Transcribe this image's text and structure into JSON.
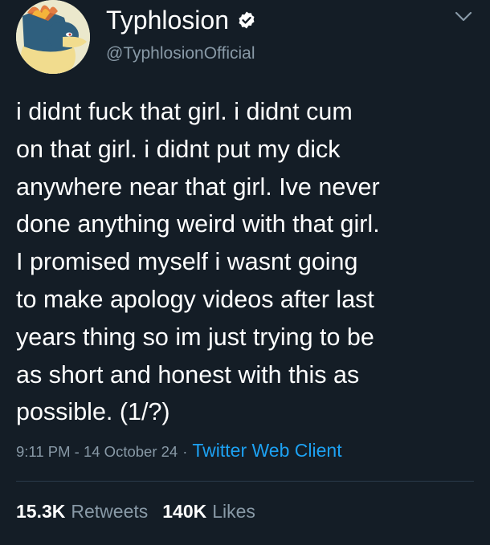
{
  "user": {
    "display_name": "Typhlosion",
    "handle": "@TyphlosionOfficial",
    "verified": true,
    "avatar_icon": "typhlosion-avatar"
  },
  "tweet": {
    "text": "i didnt fuck that girl. i didnt cum\non that girl. i didnt put my dick\nanywhere near that girl. Ive never\ndone anything weird with that girl.\nI promised myself i wasnt going\nto make apology videos after last\nyears thing so im just trying to be\nas short and honest with this as\npossible. (1/?)",
    "timestamp": "9:11 PM - 14 October 24",
    "separator": "·",
    "client": "Twitter Web Client"
  },
  "stats": {
    "retweets_count": "15.3K",
    "retweets_label": "Retweets",
    "likes_count": "140K",
    "likes_label": "Likes"
  },
  "colors": {
    "background": "#141d26",
    "secondary_text": "#8899a6",
    "link": "#1da1f2",
    "primary_text": "#ffffff"
  }
}
